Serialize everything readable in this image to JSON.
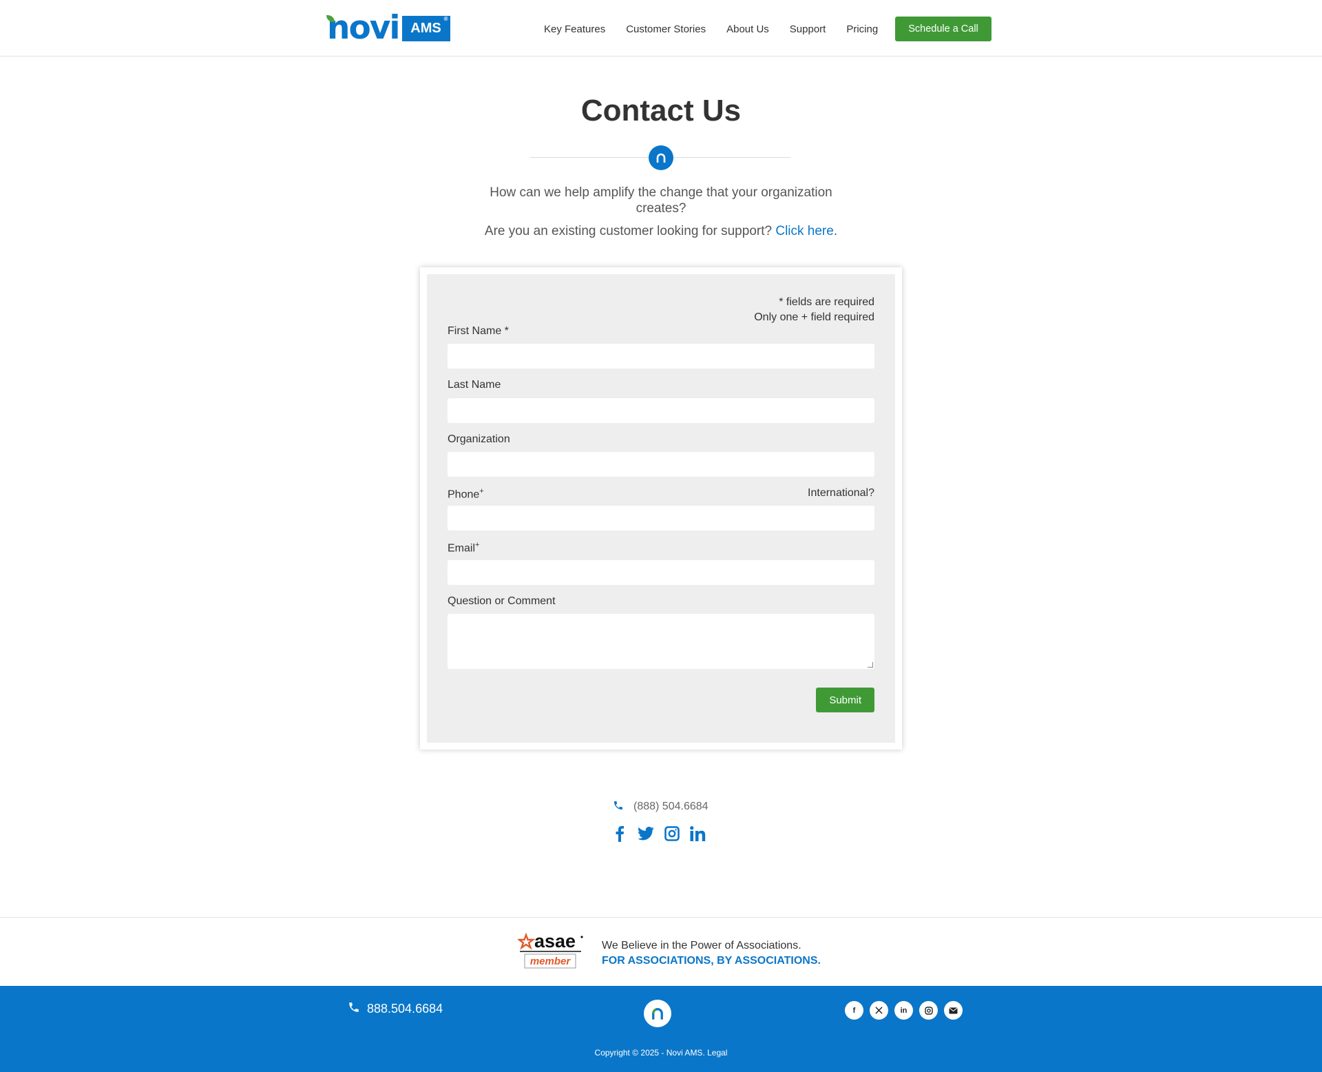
{
  "colors": {
    "brand_blue": "#0a76c9",
    "brand_green": "#3f9a36",
    "form_bg": "#eeeeee"
  },
  "header": {
    "logo": {
      "brand": "novi",
      "badge": "AMS",
      "reg": "®"
    },
    "nav": [
      "Key Features",
      "Customer Stories",
      "About Us",
      "Support",
      "Pricing"
    ],
    "cta_label": "Schedule a Call"
  },
  "hero": {
    "title": "Contact Us",
    "intro": "How can we help amplify the change that your organization creates?",
    "support_text": "Are you an existing customer looking for support? ",
    "support_link": "Click here",
    "support_end": "."
  },
  "form": {
    "required_note": "* fields are required",
    "plus_note": "Only one + field required",
    "first_name_label": "First Name *",
    "last_name_label": "Last Name",
    "organization_label": "Organization",
    "phone_label": "Phone",
    "email_label": "Email",
    "plus_mark": "+",
    "international_label": "International?",
    "comment_label": "Question or Comment",
    "submit_label": "Submit"
  },
  "contact": {
    "phone": "(888) 504.6684",
    "social_icons": [
      "facebook-icon",
      "twitter-icon",
      "instagram-icon",
      "linkedin-icon"
    ]
  },
  "asae": {
    "logo_word": "asae",
    "logo_sub": "member",
    "line1": "We Believe in the Power of Associations.",
    "line2": "FOR ASSOCIATIONS, BY ASSOCIATIONS."
  },
  "footer": {
    "phone": "888.504.6684",
    "copyright": "Copyright © 2025 - Novi AMS. Legal",
    "social_icons": [
      "facebook-icon",
      "x-icon",
      "linkedin-icon",
      "instagram-icon",
      "email-icon"
    ]
  }
}
